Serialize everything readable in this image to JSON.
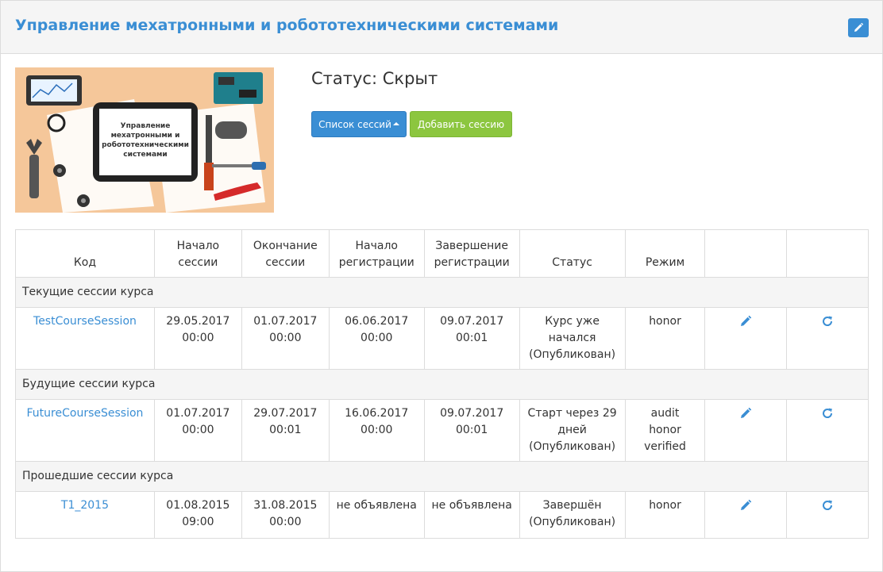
{
  "header": {
    "title": "Управление мехатронными и робототехническими системами"
  },
  "image": {
    "caption": "Управление мехатронными и робототехническими системами"
  },
  "status": {
    "label": "Статус: Скрыт"
  },
  "buttons": {
    "sessions_list": "Список сессий",
    "add_session": "Добавить сессию"
  },
  "table": {
    "headers": [
      {
        "l1": "",
        "l2": "Код"
      },
      {
        "l1": "Начало",
        "l2": "сессии"
      },
      {
        "l1": "Окончание",
        "l2": "сессии"
      },
      {
        "l1": "Начало",
        "l2": "регистрации"
      },
      {
        "l1": "Завершение",
        "l2": "регистрации"
      },
      {
        "l1": "",
        "l2": "Статус"
      },
      {
        "l1": "",
        "l2": "Режим"
      },
      {
        "l1": "",
        "l2": ""
      },
      {
        "l1": "",
        "l2": ""
      }
    ],
    "groups": [
      {
        "title": "Текущие сессии курса",
        "row": {
          "code": "TestCourseSession",
          "start": [
            "29.05.2017",
            "00:00"
          ],
          "end": [
            "01.07.2017",
            "00:00"
          ],
          "reg_start": [
            "06.06.2017",
            "00:00"
          ],
          "reg_end": [
            "09.07.2017",
            "00:01"
          ],
          "status": [
            "Курс уже",
            "начался",
            "(Опубликован)"
          ],
          "mode": [
            "honor"
          ]
        }
      },
      {
        "title": "Будущие сессии курса",
        "row": {
          "code": "FutureCourseSession",
          "start": [
            "01.07.2017",
            "00:00"
          ],
          "end": [
            "29.07.2017",
            "00:01"
          ],
          "reg_start": [
            "16.06.2017",
            "00:00"
          ],
          "reg_end": [
            "09.07.2017",
            "00:01"
          ],
          "status": [
            "Старт через 29",
            "дней",
            "(Опубликован)"
          ],
          "mode": [
            "audit",
            "honor",
            "verified"
          ]
        }
      },
      {
        "title": "Прошедшие сессии курса",
        "row": {
          "code": "T1_2015",
          "start": [
            "01.08.2015",
            "09:00"
          ],
          "end": [
            "31.08.2015",
            "00:00"
          ],
          "reg_start": [
            "не объявлена"
          ],
          "reg_end": [
            "не объявлена"
          ],
          "status": [
            "Завершён",
            "(Опубликован)"
          ],
          "mode": [
            "honor"
          ]
        }
      }
    ]
  },
  "colors": {
    "accent": "#3a8ed4",
    "green": "#8cc63f",
    "group_bg": "#f5f5f5"
  },
  "icons": {
    "edit": "pencil-icon",
    "refresh": "refresh-icon"
  }
}
